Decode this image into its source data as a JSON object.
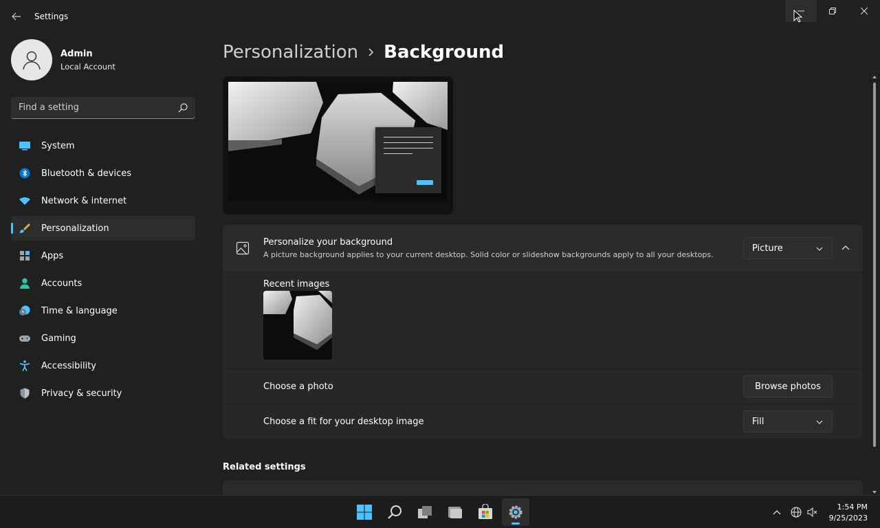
{
  "window": {
    "title": "Settings"
  },
  "profile": {
    "name": "Admin",
    "account_type": "Local Account"
  },
  "search": {
    "placeholder": "Find a setting"
  },
  "nav": {
    "items": [
      {
        "label": "System",
        "icon": "monitor-icon",
        "active": false
      },
      {
        "label": "Bluetooth & devices",
        "icon": "bluetooth-icon",
        "active": false
      },
      {
        "label": "Network & internet",
        "icon": "wifi-icon",
        "active": false
      },
      {
        "label": "Personalization",
        "icon": "brush-icon",
        "active": true
      },
      {
        "label": "Apps",
        "icon": "apps-icon",
        "active": false
      },
      {
        "label": "Accounts",
        "icon": "person-icon",
        "active": false
      },
      {
        "label": "Time & language",
        "icon": "globe-clock-icon",
        "active": false
      },
      {
        "label": "Gaming",
        "icon": "gamepad-icon",
        "active": false
      },
      {
        "label": "Accessibility",
        "icon": "accessibility-icon",
        "active": false
      },
      {
        "label": "Privacy & security",
        "icon": "shield-icon",
        "active": false
      }
    ]
  },
  "breadcrumb": {
    "parent": "Personalization",
    "current": "Background"
  },
  "background": {
    "title": "Personalize your background",
    "description": "A picture background applies to your current desktop. Solid color or slideshow backgrounds apply to all your desktops.",
    "type_value": "Picture",
    "recent_label": "Recent images",
    "choose_photo_label": "Choose a photo",
    "browse_button": "Browse photos",
    "fit_label": "Choose a fit for your desktop image",
    "fit_value": "Fill"
  },
  "related": {
    "title": "Related settings"
  },
  "taskbar": {
    "time": "1:54 PM",
    "date": "9/25/2023"
  },
  "colors": {
    "accent": "#4cc2ff",
    "background": "#202020",
    "card": "#2b2b2b"
  }
}
